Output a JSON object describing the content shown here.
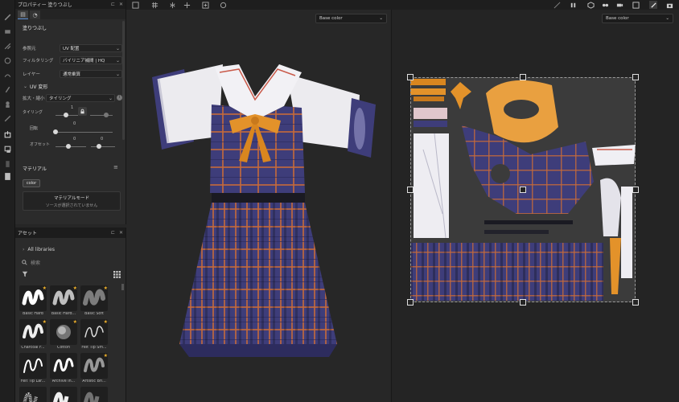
{
  "property_panel": {
    "title": "プロパティー 塗りつぶし",
    "section": "塗りつぶし",
    "rows": [
      {
        "label": "参照元",
        "value": "UV 配置"
      },
      {
        "label": "フィルタリング",
        "value": "バイリニア補間 | HQ"
      },
      {
        "label": "レイヤー",
        "value": "通常乗算"
      }
    ],
    "uv_section": "UV 変形",
    "mode_label": "拡大・縮小",
    "mode_value": "タイリング",
    "tiling_label": "タイリング",
    "tiling_value": "1",
    "rotation_label": "回転",
    "rotation_value": "0",
    "offset_label": "オフセット",
    "offset_x": "0",
    "offset_y": "0",
    "material_section": "マテリアル",
    "color_chip": "color",
    "material_mode": "マテリアルモード",
    "material_status": "ソースが選択されていません"
  },
  "asset_panel": {
    "title": "アセット",
    "library": "All libraries",
    "search_placeholder": "検索",
    "brushes": [
      {
        "name": "Basic Hard",
        "star": true
      },
      {
        "name": "Basic Hard...",
        "star": true
      },
      {
        "name": "Basic Soft",
        "star": true
      },
      {
        "name": "Charcoal F...",
        "star": true
      },
      {
        "name": "Cotton",
        "star": true
      },
      {
        "name": "Felt Tip Sm...",
        "star": true
      },
      {
        "name": "Felt Tip Lar...",
        "star": false
      },
      {
        "name": "Archive In...",
        "star": false
      },
      {
        "name": "Artistic Bri...",
        "star": true
      },
      {
        "name": "",
        "star": false
      },
      {
        "name": "",
        "star": false
      },
      {
        "name": "",
        "star": false
      }
    ]
  },
  "viewport_3d": {
    "channel": "Base color"
  },
  "viewport_uv": {
    "channel": "Base color"
  },
  "colors": {
    "cloth_navy": "#3e3d7a",
    "plaid_line": "#c76a3a",
    "bow_orange": "#e3922a",
    "shirt_white": "#ecebef",
    "accent_blue": "#5a8fd6"
  }
}
